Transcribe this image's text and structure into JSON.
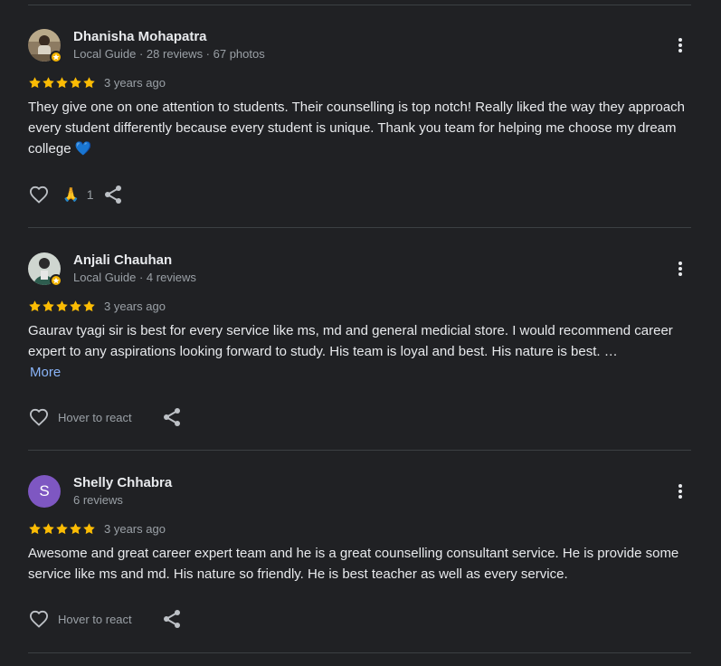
{
  "colors": {
    "background": "#202124",
    "star": "#fbbc04",
    "link": "#8ab4f8",
    "avatar_s": "#7e57c2"
  },
  "reviews": [
    {
      "name": "Dhanisha Mohapatra",
      "meta": "Local Guide · 28 reviews · 67 photos",
      "rating": 5,
      "date": "3 years ago",
      "text": "They give one on one attention to students. Their counselling is top notch! Really liked the way they approach every student differently because every student is unique. Thank you team for helping me choose my dream college 💙",
      "reaction_emoji": "🙏",
      "reaction_count": "1",
      "icons": [
        "heart-icon",
        "share-icon",
        "more-vert-icon"
      ]
    },
    {
      "name": "Anjali Chauhan",
      "meta": "Local Guide · 4 reviews",
      "rating": 5,
      "date": "3 years ago",
      "text": "Gaurav tyagi sir is best for every service like ms, md and general medicial store. I would recommend career expert to any aspirations looking forward to study. His team is loyal and best. His nature is best. …",
      "more_label": "More",
      "hover_label": "Hover to react",
      "icons": [
        "heart-icon",
        "share-icon",
        "more-vert-icon"
      ]
    },
    {
      "name": "Shelly Chhabra",
      "avatar_letter": "S",
      "meta": "6 reviews",
      "rating": 5,
      "date": "3 years ago",
      "text": "Awesome and great career expert team and he is a great counselling consultant service. He is provide some service like ms and md. His nature so friendly. He is best teacher as well as every service.",
      "hover_label": "Hover to react",
      "icons": [
        "heart-icon",
        "share-icon",
        "more-vert-icon"
      ]
    }
  ]
}
